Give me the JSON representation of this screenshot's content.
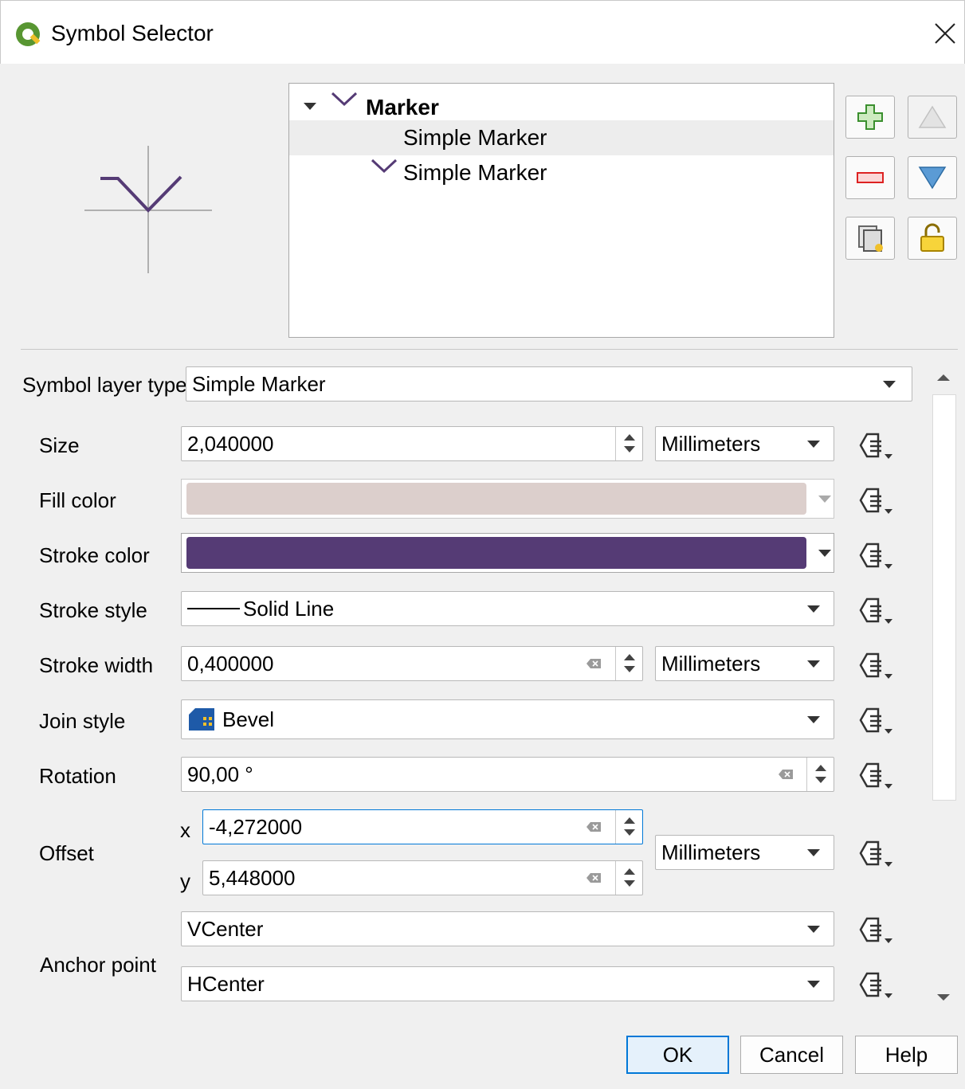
{
  "window": {
    "title": "Symbol Selector"
  },
  "tree": {
    "root_label": "Marker",
    "children": [
      {
        "label": "Simple Marker"
      },
      {
        "label": "Simple Marker"
      }
    ]
  },
  "form": {
    "symbol_layer_type_label": "Symbol layer type",
    "symbol_layer_type_value": "Simple Marker",
    "size": {
      "label": "Size",
      "value": "2,040000",
      "unit": "Millimeters"
    },
    "fill_color": {
      "label": "Fill color",
      "color": "#dccfcc"
    },
    "stroke_color": {
      "label": "Stroke color",
      "color": "#553b75"
    },
    "stroke_style": {
      "label": "Stroke style",
      "value": "Solid Line"
    },
    "stroke_width": {
      "label": "Stroke width",
      "value": "0,400000",
      "unit": "Millimeters"
    },
    "join_style": {
      "label": "Join style",
      "value": "Bevel"
    },
    "rotation": {
      "label": "Rotation",
      "value": "90,00 °"
    },
    "offset": {
      "label": "Offset",
      "x_label": "x",
      "x_value": "-4,272000",
      "y_label": "y",
      "y_value": "5,448000",
      "unit": "Millimeters"
    },
    "anchor_point": {
      "label": "Anchor point",
      "vertical": "VCenter",
      "horizontal": "HCenter"
    }
  },
  "buttons": {
    "ok": "OK",
    "cancel": "Cancel",
    "help": "Help"
  },
  "colors": {
    "marker_stroke": "#553b75",
    "accent": "#0078d7"
  }
}
